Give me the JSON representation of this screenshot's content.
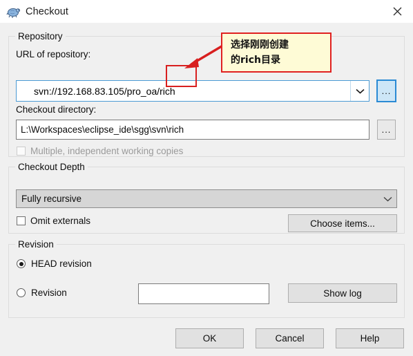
{
  "window": {
    "title": "Checkout",
    "icon": "tortoise-icon",
    "close_label": "✕"
  },
  "repository": {
    "group_title": "Repository",
    "url_label": "URL of repository:",
    "url_value": "svn://192.168.83.105/pro_oa/rich",
    "url_placeholder": "",
    "dropdown_icon": "chevron-down-icon",
    "browse_label": "...",
    "dir_label": "Checkout directory:",
    "dir_value": "L:\\Workspaces\\eclipse_ide\\sgg\\svn\\rich",
    "dir_placeholder": "",
    "dir_browse_label": "...",
    "multiple_copies_label": "Multiple, independent working copies",
    "multiple_copies_checked": false,
    "multiple_copies_enabled": false
  },
  "depth": {
    "group_title": "Checkout Depth",
    "selected": "Fully recursive",
    "dropdown_icon": "chevron-down-icon",
    "omit_externals_label": "Omit externals",
    "omit_externals_checked": false,
    "choose_items_label": "Choose items..."
  },
  "revision": {
    "group_title": "Revision",
    "head_label": "HEAD revision",
    "head_selected": true,
    "revision_label": "Revision",
    "revision_selected": false,
    "revision_value": "",
    "revision_placeholder": "",
    "show_log_label": "Show log"
  },
  "buttons": {
    "ok": "OK",
    "cancel": "Cancel",
    "help": "Help"
  },
  "annotation": {
    "line1": "选择刚刚创建",
    "line2": "的rich目录",
    "box_color": "#fefbd6",
    "border_color": "#e02020",
    "arrow_color": "#d81f1f"
  },
  "colors": {
    "window_bg": "#f0f0f0",
    "titlebar_bg": "#ffffff",
    "focus_blue": "#2a8ad4",
    "focus_fill": "#cde6f7",
    "combo_gray": "#d6d6d6",
    "button_gray": "#e1e1e1"
  }
}
